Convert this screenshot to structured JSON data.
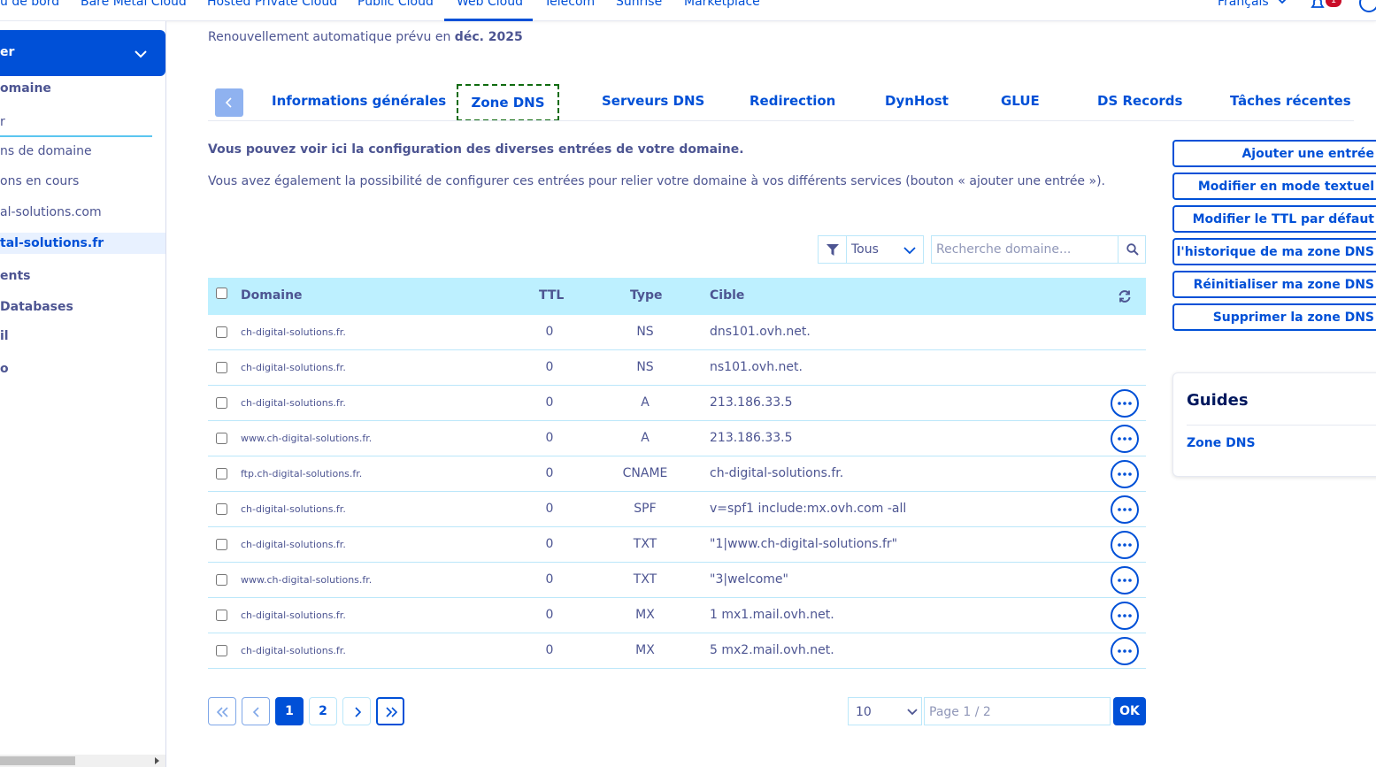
{
  "topnav": {
    "items": [
      {
        "label": "u de bord"
      },
      {
        "label": "Bare Metal Cloud"
      },
      {
        "label": "Hosted Private Cloud"
      },
      {
        "label": "Public Cloud"
      },
      {
        "label": "Web Cloud"
      },
      {
        "label": "Telecom"
      },
      {
        "label": "Sunrise"
      },
      {
        "label": "Marketplace"
      }
    ],
    "language": "Français",
    "notif_count": "1"
  },
  "sidebar": {
    "header_label": "er",
    "items": [
      {
        "label": "omaine"
      },
      {
        "label": "r"
      },
      {
        "label": "ns de domaine"
      },
      {
        "label": "ons en cours"
      },
      {
        "label": "al-solutions.com"
      },
      {
        "label": "tal-solutions.fr"
      },
      {
        "label": "ents"
      },
      {
        "label": " Databases"
      },
      {
        "label": "il"
      },
      {
        "label": "o"
      }
    ]
  },
  "renewal": {
    "prefix": "Renouvellement automatique prévu en ",
    "date": "déc. 2025"
  },
  "tabs": [
    {
      "label": "Informations générales"
    },
    {
      "label": "Zone DNS"
    },
    {
      "label": "Serveurs DNS"
    },
    {
      "label": "Redirection"
    },
    {
      "label": "DynHost"
    },
    {
      "label": "GLUE"
    },
    {
      "label": "DS Records"
    },
    {
      "label": "Tâches récentes"
    }
  ],
  "intro": {
    "line1": "Vous pouvez voir ici la configuration des diverses entrées de votre domaine.",
    "line2": "Vous avez également la possibilité de configurer ces entrées pour relier votre domaine à vos différents services (bouton « ajouter une entrée »)."
  },
  "filter": {
    "selected": "Tous"
  },
  "search": {
    "placeholder": "Recherche domaine..."
  },
  "table": {
    "headers": {
      "domain": "Domaine",
      "ttl": "TTL",
      "type": "Type",
      "target": "Cible"
    },
    "rows": [
      {
        "domain": "ch-digital-solutions.fr.",
        "ttl": "0",
        "type": "NS",
        "target": "dns101.ovh.net.",
        "actions": false
      },
      {
        "domain": "ch-digital-solutions.fr.",
        "ttl": "0",
        "type": "NS",
        "target": "ns101.ovh.net.",
        "actions": false
      },
      {
        "domain": "ch-digital-solutions.fr.",
        "ttl": "0",
        "type": "A",
        "target": "213.186.33.5",
        "actions": true
      },
      {
        "domain": "www.ch-digital-solutions.fr.",
        "ttl": "0",
        "type": "A",
        "target": "213.186.33.5",
        "actions": true
      },
      {
        "domain": "ftp.ch-digital-solutions.fr.",
        "ttl": "0",
        "type": "CNAME",
        "target": "ch-digital-solutions.fr.",
        "actions": true
      },
      {
        "domain": "ch-digital-solutions.fr.",
        "ttl": "0",
        "type": "SPF",
        "target": "v=spf1 include:mx.ovh.com -all",
        "actions": true
      },
      {
        "domain": "ch-digital-solutions.fr.",
        "ttl": "0",
        "type": "TXT",
        "target": "\"1|www.ch-digital-solutions.fr\"",
        "actions": true
      },
      {
        "domain": "www.ch-digital-solutions.fr.",
        "ttl": "0",
        "type": "TXT",
        "target": "\"3|welcome\"",
        "actions": true
      },
      {
        "domain": "ch-digital-solutions.fr.",
        "ttl": "0",
        "type": "MX",
        "target": "1 mx1.mail.ovh.net.",
        "actions": true
      },
      {
        "domain": "ch-digital-solutions.fr.",
        "ttl": "0",
        "type": "MX",
        "target": "5 mx2.mail.ovh.net.",
        "actions": true
      }
    ]
  },
  "pagination": {
    "pages": [
      "1",
      "2"
    ],
    "page_size": "10",
    "page_placeholder": "Page 1 / 2",
    "ok_label": "OK"
  },
  "actions": [
    {
      "label": "Ajouter une entrée"
    },
    {
      "label": "Modifier en mode textuel"
    },
    {
      "label": "Modifier le TTL par défaut"
    },
    {
      "label": "Voir l'historique de ma zone DNS"
    },
    {
      "label": "Réinitialiser ma zone DNS"
    },
    {
      "label": "Supprimer la zone DNS"
    }
  ],
  "guides": {
    "title": "Guides",
    "link": "Zone DNS"
  },
  "colors": {
    "primary": "#0050d7",
    "header_bg": "#bdf0ff",
    "text": "#4d5592"
  }
}
